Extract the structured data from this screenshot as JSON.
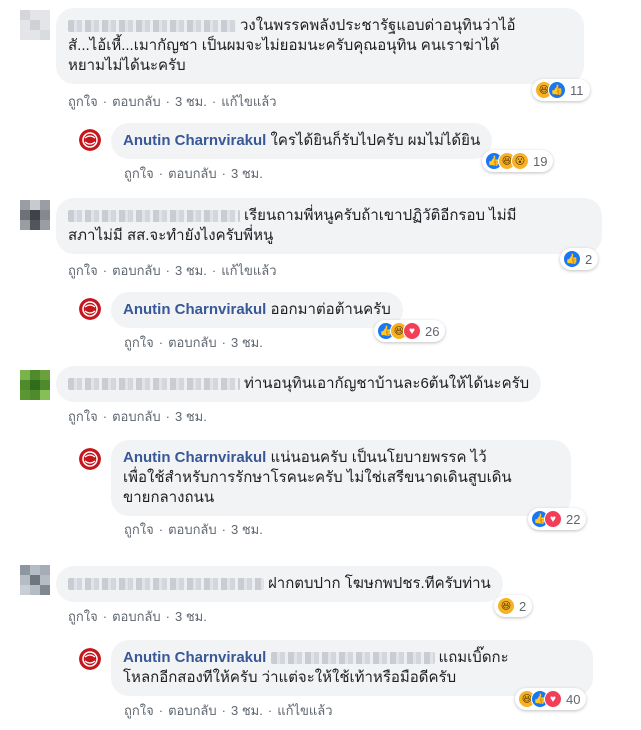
{
  "page_name": "Anutin Charnvirakul",
  "actions": {
    "like": "ถูกใจ",
    "reply": "ตอบกลับ",
    "edited": "แก้ไขแล้ว",
    "sep": "·"
  },
  "comments": [
    {
      "text_l1": "วงในพรรคพลังประชารัฐแอบด่าอนุทินว่าไอ้",
      "text_l2": "สั...ไอ้เหี้...เมากัญชา เป็นผมจะไม่ยอมนะครับคุณอนุทิน คนเราฆ่าได้",
      "text_l3": "หยามไม่ได้นะครับ",
      "time": "3 ชม.",
      "count": "11",
      "reactions": [
        "haha-icon",
        "like-icon"
      ],
      "reply": {
        "text": "ใครได้ยินก็รับไปครับ ผมไม่ได้ยิน",
        "time": "3 ชม.",
        "count": "19",
        "reactions": [
          "like-icon",
          "haha-icon",
          "wow-icon"
        ]
      }
    },
    {
      "text_l1": "เรียนถามพี่หนูครับถ้าเขาปฏิวัติอีกรอบ ไม่มี",
      "text_l2": "สภาไม่มี สส.จะทำยังไงครับพี่หนู",
      "time": "3 ชม.",
      "count": "2",
      "reactions": [
        "like-icon"
      ],
      "reply": {
        "text": "ออกมาต่อต้านครับ",
        "time": "3 ชม.",
        "count": "26",
        "reactions": [
          "like-icon",
          "haha-icon",
          "love-icon"
        ]
      }
    },
    {
      "text_l1": "ท่านอนุทินเอากัญชาบ้านละ6ต้นให้ได้นะครับ",
      "time": "3 ชม.",
      "reply": {
        "text_l1": "แน่นอนครับ เป็นนโยบายพรรค ไว้",
        "text_l2": "เพื่อใช้สำหรับการรักษาโรคนะครับ ไม่ใช่เสรีขนาดเดินสูบเดิน",
        "text_l3": "ขายกลางถนน",
        "time": "3 ชม.",
        "count": "22",
        "reactions": [
          "like-icon",
          "love-icon"
        ]
      }
    },
    {
      "text_l1": "ฝากตบปาก โฆษกพปชร.ทีครับท่าน",
      "time": "3 ชม.",
      "count": "2",
      "reactions": [
        "haha-icon"
      ],
      "reply": {
        "text_l1": "แถมเบิ๊ดกะ",
        "text_l2": "โหลกอีกสองทีให้ครับ ว่าแต่จะให้ใช้เท้าหรือมือดีครับ",
        "time": "3 ชม.",
        "count": "40",
        "reactions": [
          "haha-icon",
          "like-icon",
          "love-icon"
        ]
      }
    }
  ],
  "colors": {
    "name": "#385898",
    "bubble": "#f2f3f5",
    "meta": "#606770",
    "like": "#1877f2",
    "love": "#f33e58",
    "haha": "#f7b125"
  }
}
